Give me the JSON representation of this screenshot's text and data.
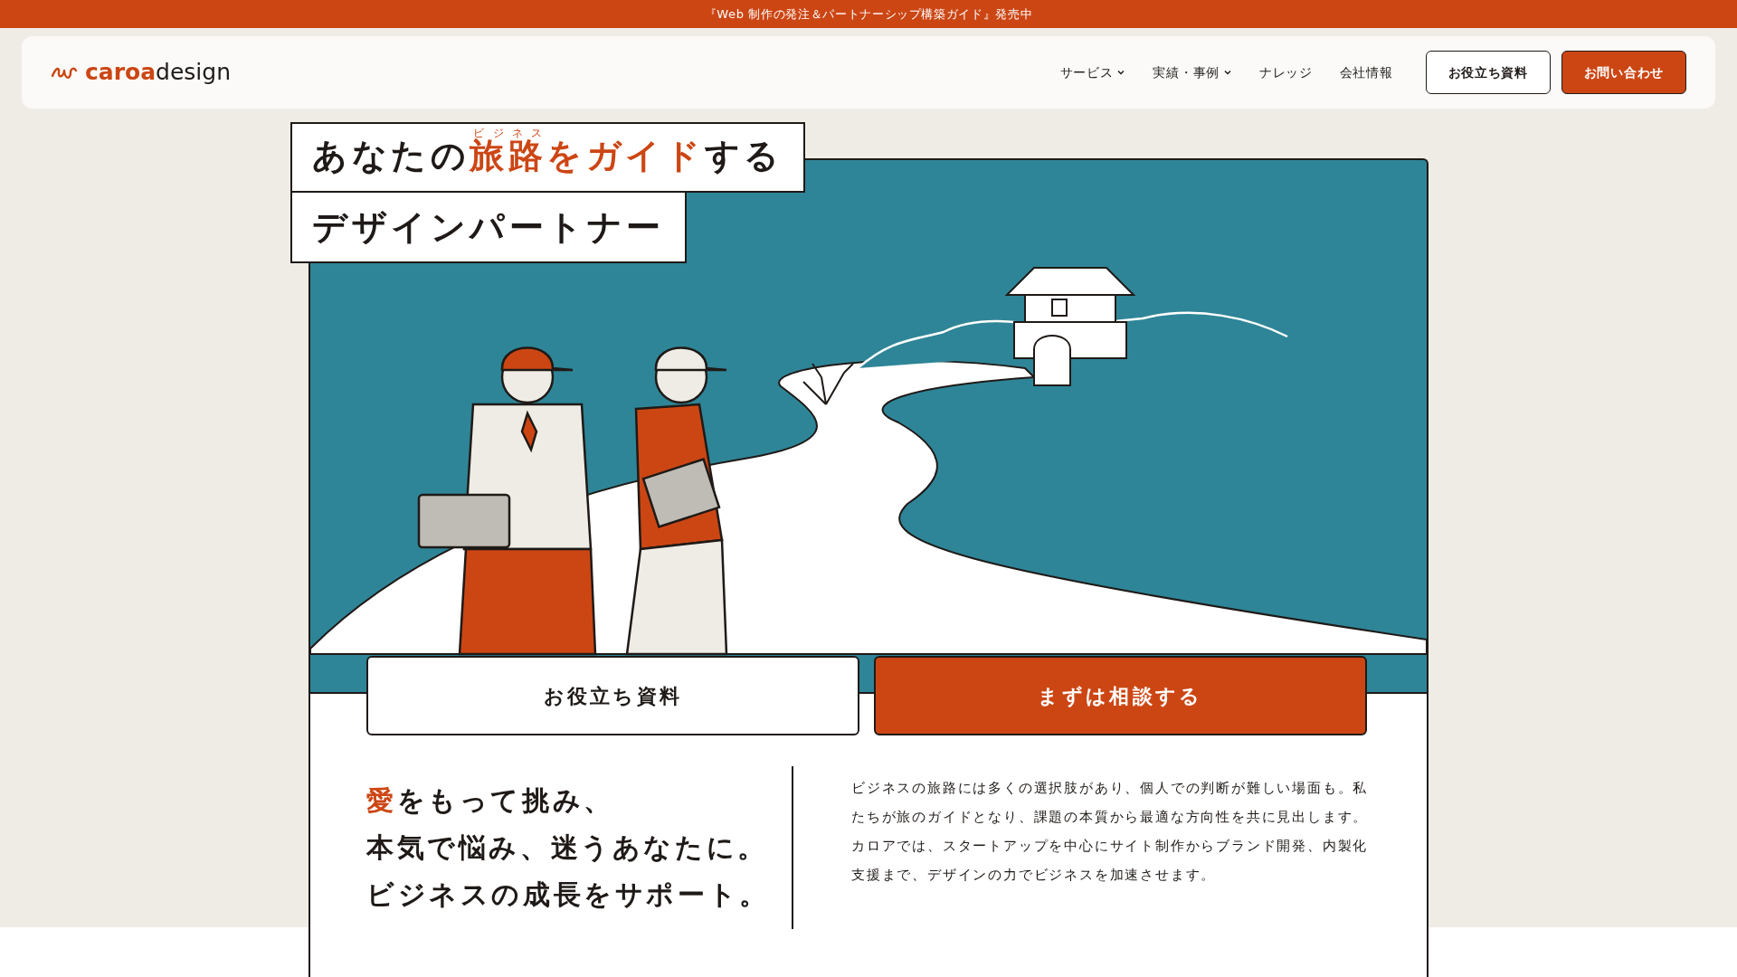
{
  "announcement": "『Web 制作の発注＆パートナーシップ構築ガイド』発売中",
  "logo": {
    "brand": "caroa",
    "suffix": "design"
  },
  "nav": [
    {
      "label": "サービス",
      "has_dropdown": true
    },
    {
      "label": "実績・事例",
      "has_dropdown": true
    },
    {
      "label": "ナレッジ",
      "has_dropdown": false
    },
    {
      "label": "会社情報",
      "has_dropdown": false
    }
  ],
  "header_buttons": [
    {
      "label": "お役立ち資料",
      "kind": "outline"
    },
    {
      "label": "お問い合わせ",
      "kind": "primary"
    }
  ],
  "headline": {
    "before": "あなたの",
    "ruby_base": "旅路",
    "ruby": "ビジネス",
    "highlight_rest": "をガイド",
    "after": "する",
    "line2": "デザインパートナー"
  },
  "hero_buttons": [
    {
      "label": "お役立ち資料",
      "kind": "outline"
    },
    {
      "label": "まずは相談する",
      "kind": "primary"
    }
  ],
  "lead": {
    "accent": "愛",
    "first_rest": "をもって挑み、",
    "lines": [
      "本気で悩み、迷うあなたに。",
      "ビジネスの成長をサポート。"
    ]
  },
  "description": [
    "ビジネスの旅路には多くの選択肢があり、個人での判断が難しい場面も。私たちが旅のガイドとなり、課題の本質から最適な方向性を共に見出します。",
    "カロアでは、スタートアップを中心にサイト制作からブランド開発、内製化支援まで、デザインの力でビジネスを加速させます。"
  ]
}
